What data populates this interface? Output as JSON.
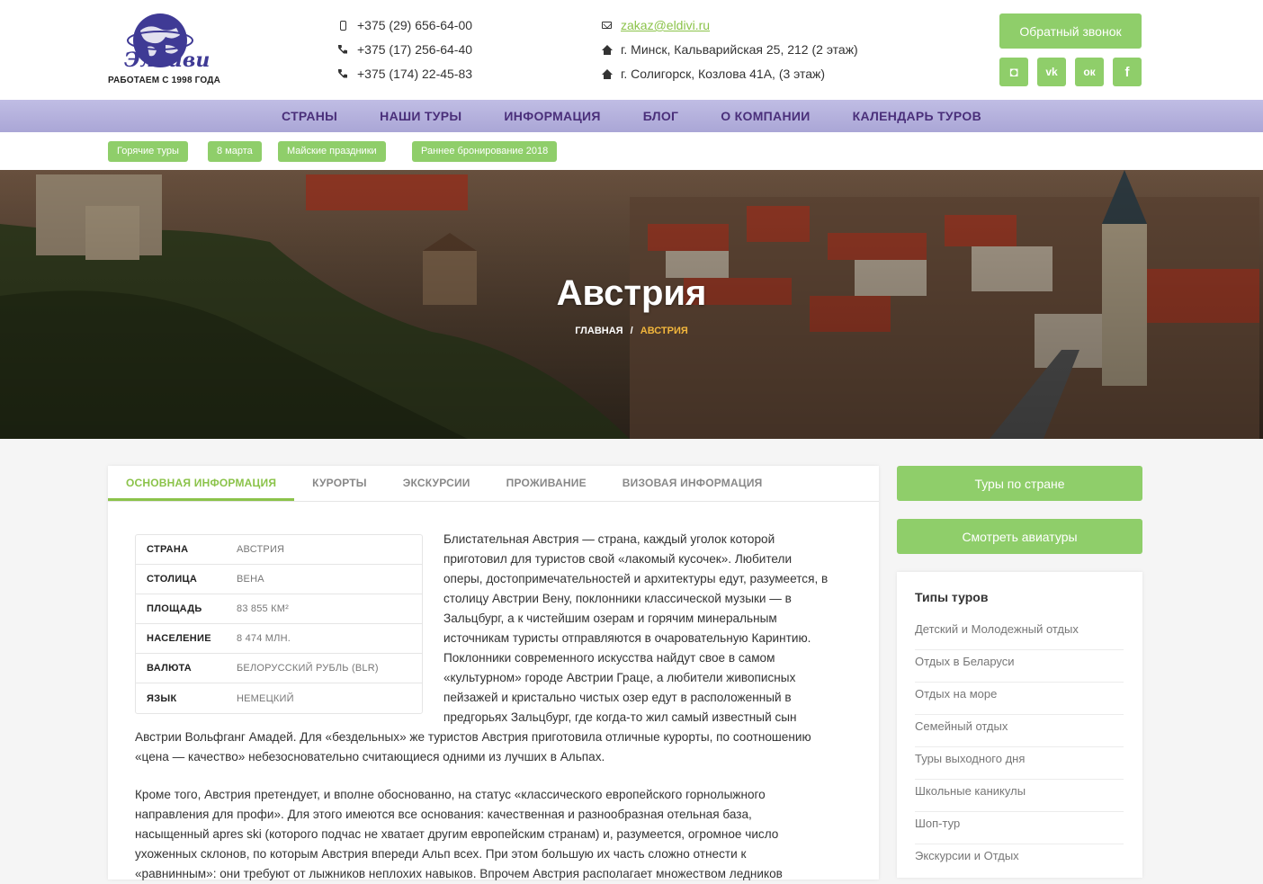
{
  "header": {
    "logo_text": "Элдиви",
    "logo_tagline": "РАБОТАЕМ С 1998 ГОДА",
    "phones": [
      "+375 (29) 656-64-00",
      "+375 (17) 256-64-40",
      "+375 (174) 22-45-83"
    ],
    "email": "zakaz@eldivi.ru",
    "addresses": [
      "г. Минск, Кальварийская 25, 212 (2 этаж)",
      "г. Солигорск, Козлова 41А, (3 этаж)"
    ],
    "callback_label": "Обратный звонок",
    "social": [
      "instagram-icon",
      "vk-icon",
      "odnoklassniki-icon",
      "facebook-icon"
    ],
    "social_glyphs": [
      "◘",
      "vk",
      "ок",
      "f"
    ]
  },
  "nav": {
    "items": [
      "СТРАНЫ",
      "НАШИ ТУРЫ",
      "ИНФОРМАЦИЯ",
      "БЛОГ",
      "О КОМПАНИИ",
      "КАЛЕНДАРЬ ТУРОВ"
    ]
  },
  "tags": [
    "Горячие туры",
    "8 марта",
    "Майские праздники",
    "Раннее бронирование 2018"
  ],
  "hero": {
    "title": "Австрия",
    "breadcrumb_home": "ГЛАВНАЯ",
    "breadcrumb_sep": "/",
    "breadcrumb_current": "АВСТРИЯ"
  },
  "tabs": [
    "ОСНОВНАЯ ИНФОРМАЦИЯ",
    "КУРОРТЫ",
    "ЭКСКУРСИИ",
    "ПРОЖИВАНИЕ",
    "ВИЗОВАЯ ИНФОРМАЦИЯ"
  ],
  "info_table": [
    {
      "k": "СТРАНА",
      "v": "АВСТРИЯ"
    },
    {
      "k": "СТОЛИЦА",
      "v": "ВЕНА"
    },
    {
      "k": "ПЛОЩАДЬ",
      "v": "83 855 КМ²"
    },
    {
      "k": "НАСЕЛЕНИЕ",
      "v": "8 474 МЛН."
    },
    {
      "k": "ВАЛЮТА",
      "v": "БЕЛОРУССКИЙ РУБЛЬ (BLR)"
    },
    {
      "k": "ЯЗЫК",
      "v": "НЕМЕЦКИЙ"
    }
  ],
  "text_right_lines": [
    "Блистательная Австрия — страна, каждый уголок которой",
    "приготовил для туристов свой «лакомый кусочек». Любители",
    "оперы, достопримечательностей и архитектуры едут, разумеется, в",
    "столицу Австрии Вену, поклонники классической музыки — в",
    "Зальцбург, а к чистейшим озерам и горячим минеральным",
    "источникам туристы отправляются в очаровательную Каринтию.",
    "Поклонники современного искусства найдут свое в самом",
    "«культурном» городе Австрии Граце, а любители живописных",
    "пейзажей и кристально чистых озер едут в расположенный в",
    "предгорьях Зальцбург, где когда-то жил самый известный сын"
  ],
  "text_full_lines": [
    "Австрии Вольфганг Амадей. Для «бездельных» же туристов Австрия приготовила отличные курорты, по соотношению",
    "«цена — качество» небезосновательно считающиеся одними из лучших в Альпах."
  ],
  "text_para2_lines": [
    "Кроме того, Австрия претендует, и вполне обоснованно, на статус «классического европейского горнолыжного",
    "направления для профи». Для этого имеются все основания: качественная и разнообразная отельная база,",
    "насыщенный apres ski (которого подчас не хватает другим европейским странам) и, разумеется, огромное число",
    "ухоженных склонов, по которым Австрия впереди Альп всех. При этом большую их часть сложно отнести к",
    "«равнинным»: они требуют от лыжников неплохих навыков. Впрочем Австрия располагает множеством ледников"
  ],
  "sidebar": {
    "btn_tours": "Туры по стране",
    "btn_avia": "Смотреть авиатуры",
    "types_title": "Типы туров",
    "types": [
      "Детский и Молодежный отдых",
      "Отдых в Беларуси",
      "Отдых на море",
      "Семейный отдых",
      "Туры выходного дня",
      "Школьные каникулы",
      "Шоп-тур",
      "Экскурсии и Отдых"
    ]
  },
  "colors": {
    "accent": "#8fce6a",
    "nav": "#b5b2dc",
    "nav_text": "#4a2f7a",
    "crumb_current": "#f2b63c"
  }
}
